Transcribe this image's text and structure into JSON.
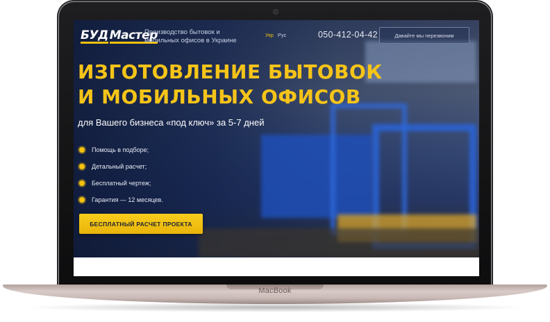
{
  "device": {
    "label": "MacBook"
  },
  "site": {
    "logo": {
      "left": "БУД",
      "right": "Мастер"
    },
    "tagline": "Производство бытовок и мобильных офисов в Украине",
    "languages": {
      "active": "Укр",
      "other": "Рус"
    },
    "phone": "050-412-04-42",
    "callback_button": "Давайте мы перезвоним",
    "headline_line1": "ИЗГОТОВЛЕНИЕ БЫТОВОК",
    "headline_line2": "И МОБИЛЬНЫХ ОФИСОВ",
    "subheadline": "для Вашего бизнеса «под ключ» за 5-7 дней",
    "features": [
      "Помощь в подборе;",
      "Детальный расчет;",
      "Бесплатный чертеж;",
      "Гарантия — 12 месяцев."
    ],
    "cta_button": "БЕСПЛАТНЫЙ РАСЧЕТ ПРОЕКТА"
  },
  "colors": {
    "accent": "#f4c20d",
    "headline": "#f6c419",
    "hero_dark": "#12224a"
  }
}
